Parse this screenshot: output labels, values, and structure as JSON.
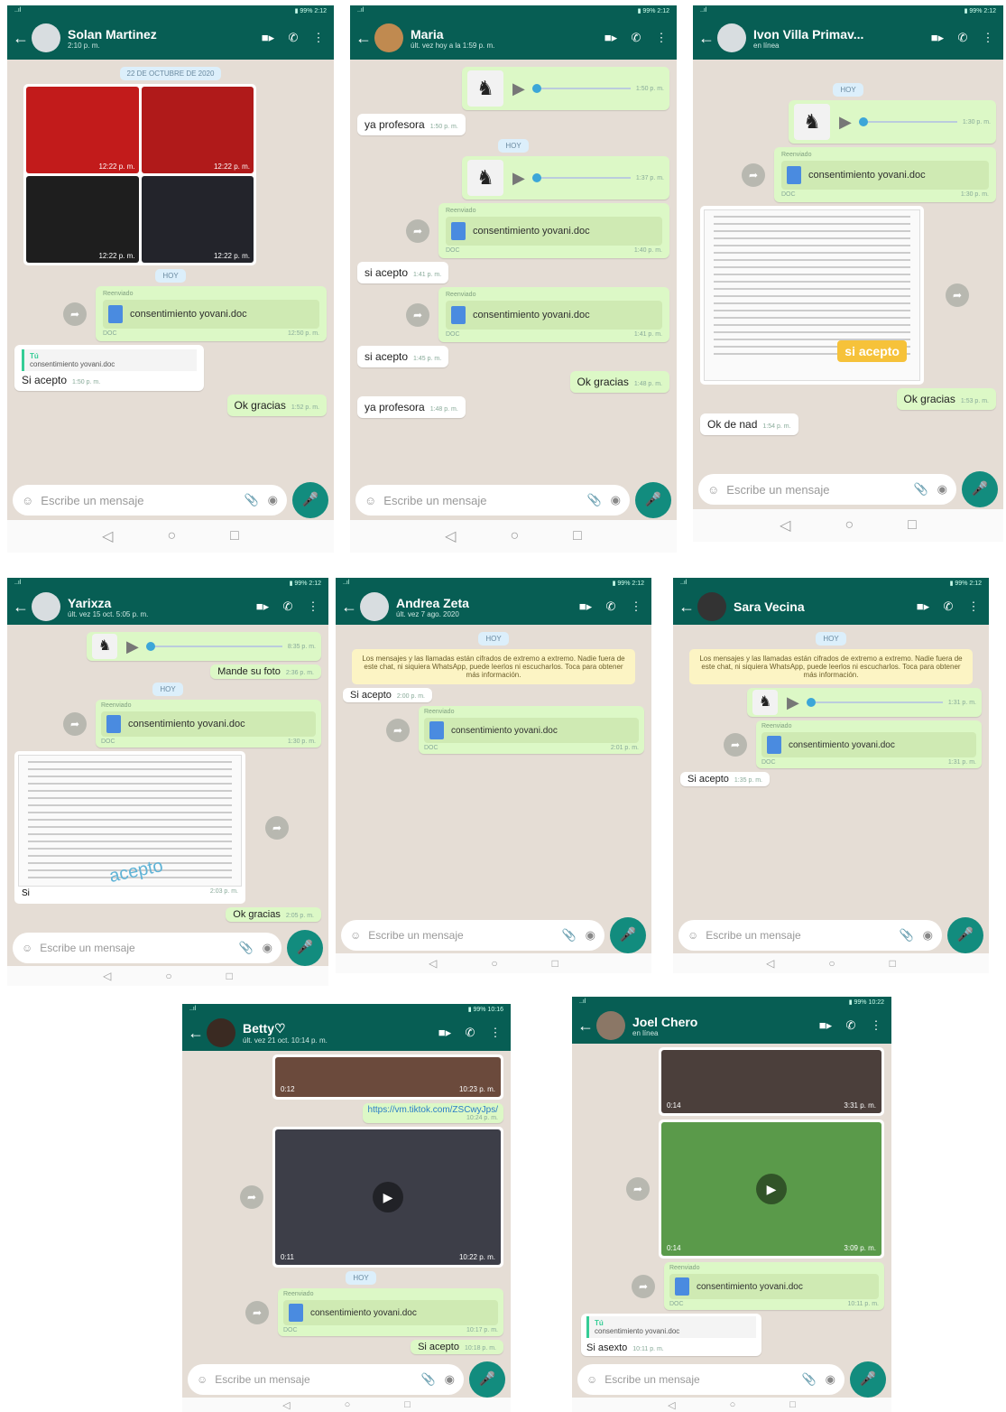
{
  "common": {
    "input_placeholder": "Escribe un mensaje",
    "status_left": "..ıl",
    "status_right": "▮ 99% 2:12"
  },
  "p1": {
    "name": "Solan Martinez",
    "sub": "2:10 p. m.",
    "date": "22 DE OCTUBRE DE 2020",
    "photo_times": [
      "12:22 p. m.",
      "12:22 p. m.",
      "12:22 p. m.",
      "12:22 p. m."
    ],
    "today": "HOY",
    "forwarded": "Reenviado",
    "doc": "consentimiento yovani.doc",
    "doc_type": "DOC",
    "doc_time": "12:50 p. m.",
    "quote_author": "Tú",
    "quote_text": "consentimiento yovani.doc",
    "reply": "Si acepto",
    "reply_time": "1:50 p. m.",
    "ok": "Ok gracias",
    "ok_time": "1:52 p. m."
  },
  "p2": {
    "name": "Maria",
    "sub": "últ. vez hoy a la 1:59 p. m.",
    "voice1_dur": "0:32",
    "voice1_time": "1:50 p. m.",
    "m1": "ya profesora",
    "m1_time": "1:50 p. m.",
    "today": "HOY",
    "voice2_dur": "0:37",
    "voice2_time": "1:37 p. m.",
    "forwarded": "Reenviado",
    "doc": "consentimiento yovani.doc",
    "doc_type": "DOC",
    "doc_time1": "1:40 p. m.",
    "m2": "si acepto",
    "m2_time": "1:41 p. m.",
    "doc_time2": "1:41 p. m.",
    "m3": "si acepto",
    "m3_time": "1:45 p. m.",
    "ok": "Ok gracias",
    "ok_time": "1:48 p. m.",
    "m4": "ya profesora",
    "m4_time": "1:48 p. m."
  },
  "p3": {
    "name": "Ivon Villa Primav...",
    "sub": "en línea",
    "today": "HOY",
    "voice_dur": "0:17",
    "voice_time": "1:30 p. m.",
    "forwarded": "Reenviado",
    "doc": "consentimiento yovani.doc",
    "doc_type": "DOC",
    "doc_time": "1:30 p. m.",
    "sticker": "si acepto",
    "ok": "Ok gracias",
    "ok_time": "1:53 p. m.",
    "reply": "Ok de nad",
    "reply_time": "1:54 p. m."
  },
  "p4": {
    "name": "Yarixza",
    "sub": "últ. vez 15 oct. 5:05 p. m.",
    "voice_dur": "0:56",
    "voice_time": "8:35 p. m.",
    "m1": "Mande su foto",
    "m1_time": "2:36 p. m.",
    "today": "HOY",
    "forwarded": "Reenviado",
    "doc": "consentimiento yovani.doc",
    "doc_type": "DOC",
    "doc_time": "1:30 p. m.",
    "img_caption": "Si",
    "img_time": "2:03 p. m.",
    "sticker": "acepto",
    "ok": "Ok gracias",
    "ok_time": "2:05 p. m."
  },
  "p5": {
    "name": "Andrea Zeta",
    "sub": "últ. vez 7 ago. 2020",
    "today": "HOY",
    "notice": "Los mensajes y las llamadas están cifrados de extremo a extremo. Nadie fuera de este chat, ni siquiera WhatsApp, puede leerlos ni escucharlos. Toca para obtener más información.",
    "m1": "Si acepto",
    "m1_time": "2:00 p. m.",
    "forwarded": "Reenviado",
    "doc": "consentimiento yovani.doc",
    "doc_type": "DOC",
    "doc_time": "2:01 p. m."
  },
  "p6": {
    "name": "Sara Vecina",
    "today": "HOY",
    "notice": "Los mensajes y las llamadas están cifrados de extremo a extremo. Nadie fuera de este chat, ni siquiera WhatsApp, puede leerlos ni escucharlos. Toca para obtener más información.",
    "voice_dur": "0:19",
    "voice_time": "1:31 p. m.",
    "forwarded": "Reenviado",
    "doc": "consentimiento yovani.doc",
    "doc_type": "DOC",
    "doc_time": "1:31 p. m.",
    "m1": "Si acepto",
    "m1_time": "1:35 p. m."
  },
  "p7": {
    "name": "Betty♡",
    "sub": "últ. vez 21 oct. 10:14 p. m.",
    "status_right": "▮ 99% 10:16",
    "vid1_dur": "0:12",
    "vid1_time": "10:23 p. m.",
    "link": "https://vm.tiktok.com/ZSCwyJps/",
    "link_time": "10:24 p. m.",
    "vid2_dur": "0:11",
    "vid2_time": "10:22 p. m.",
    "today": "HOY",
    "forwarded": "Reenviado",
    "doc": "consentimiento yovani.doc",
    "doc_type": "DOC",
    "doc_time": "10:17 p. m.",
    "m1": "Si acepto",
    "m1_time": "10:18 p. m."
  },
  "p8": {
    "name": "Joel Chero",
    "sub": "en línea",
    "status_right": "▮ 99% 10:22",
    "vid1_dur": "0:14",
    "vid1_time": "3:31 p. m.",
    "vid2_dur": "0:14",
    "vid2_time": "3:09 p. m.",
    "forwarded": "Reenviado",
    "doc": "consentimiento yovani.doc",
    "doc_type": "DOC",
    "doc_time": "10:11 p. m.",
    "quote_author": "Tú",
    "quote_text": "consentimiento yovani.doc",
    "m1": "Si asexto",
    "m1_time": "10:11 p. m."
  }
}
